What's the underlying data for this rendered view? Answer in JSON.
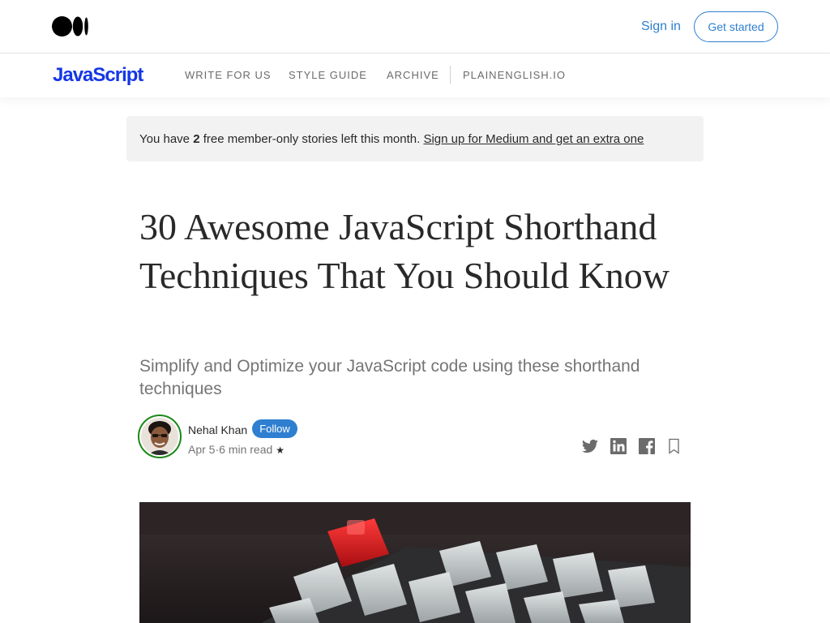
{
  "header": {
    "logo_icon": "medium-logo-icon",
    "sign_in": "Sign in",
    "get_started": "Get started",
    "accent": "#2f7fd1"
  },
  "publication": {
    "name": "JavaScript",
    "brand_color": "#1437e6",
    "nav": [
      "WRITE FOR US",
      "STYLE GUIDE",
      "ARCHIVE",
      "PLAINENGLISH.IO"
    ]
  },
  "banner": {
    "prefix": "You have ",
    "count": "2",
    "suffix": " free member-only stories left this month. ",
    "link": "Sign up for Medium and get an extra one"
  },
  "article": {
    "title": "30 Awesome JavaScript Shorthand Techniques That You Should Know",
    "subtitle": "Simplify and Optimize your JavaScript code using these shorthand techniques",
    "author": "Nehal Khan",
    "follow": "Follow",
    "date": "Apr 5",
    "separator": "·",
    "read_time": "6 min read",
    "member_star": "★"
  },
  "share_icons": [
    "twitter-icon",
    "linkedin-icon",
    "facebook-icon",
    "bookmark-icon"
  ]
}
